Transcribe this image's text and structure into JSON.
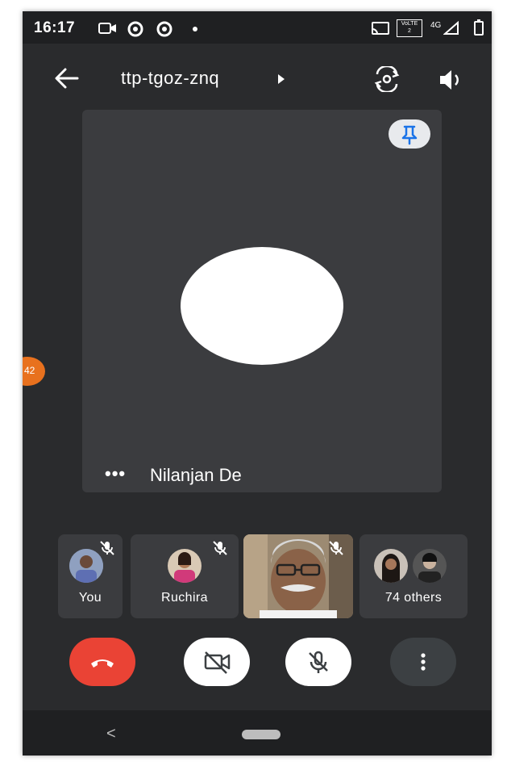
{
  "status_bar": {
    "time": "16:17",
    "volte_label": "VoLTE",
    "network_label": "4G"
  },
  "header": {
    "meeting_code": "ttp-tgoz-znq",
    "icons": [
      "back-arrow-icon",
      "switch-camera-icon",
      "speaker-icon"
    ]
  },
  "main_tile": {
    "participant_name": "Nilanjan De",
    "dots": "•••",
    "pin_icon": "pin-icon"
  },
  "side_badge": {
    "text": "42"
  },
  "participants": [
    {
      "label": "You",
      "muted": true
    },
    {
      "label": "Ruchira",
      "muted": true
    },
    {
      "label": "",
      "muted": true,
      "video": true
    },
    {
      "label": "74 others",
      "muted": false
    }
  ],
  "controls": [
    {
      "name": "end-call",
      "icon": "phone-hangup-icon",
      "color": "#ea4335"
    },
    {
      "name": "camera-off",
      "icon": "videocam-off-icon",
      "color": "#ffffff"
    },
    {
      "name": "mic-off",
      "icon": "mic-off-icon",
      "color": "#ffffff"
    },
    {
      "name": "more-options",
      "icon": "more-vert-icon",
      "color": "#3c4043"
    }
  ],
  "nav": {
    "back_glyph": "<"
  },
  "colors": {
    "background": "#2a2b2d",
    "tile": "#3b3c3f",
    "accent_pin": "#1a73e8",
    "end_call": "#ea4335",
    "badge": "#e8711e"
  }
}
